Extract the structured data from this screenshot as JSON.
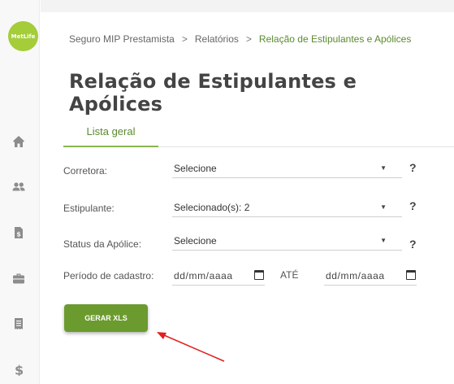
{
  "sidebar": {
    "logo_text": "MetLife",
    "icons": [
      "home-icon",
      "users-icon",
      "document-dollar-icon",
      "briefcase-icon",
      "receipt-icon",
      "dollar-icon"
    ]
  },
  "breadcrumb": {
    "items": [
      "Seguro MIP Prestamista",
      "Relatórios",
      "Relação de Estipulantes e Apólices"
    ],
    "separator": ">"
  },
  "page": {
    "title": "Relação de Estipulantes e Apólices"
  },
  "tabs": [
    {
      "label": "Lista geral",
      "active": true
    }
  ],
  "form": {
    "corretora": {
      "label": "Corretora:",
      "value": "Selecione"
    },
    "estipulante": {
      "label": "Estipulante:",
      "value": "Selecionado(s): 2"
    },
    "status": {
      "label": "Status da Apólice:",
      "value": "Selecione"
    },
    "periodo": {
      "label": "Período de cadastro:",
      "from": "dd/mm/aaaa",
      "between": "ATÉ",
      "to": "dd/mm/aaaa"
    },
    "help": "?",
    "caret": "▼"
  },
  "actions": {
    "generate_label": "GERAR XLS"
  },
  "colors": {
    "accent": "#6b9b2e",
    "brand_logo": "#a4cd39",
    "annotation_arrow": "#e02020"
  }
}
